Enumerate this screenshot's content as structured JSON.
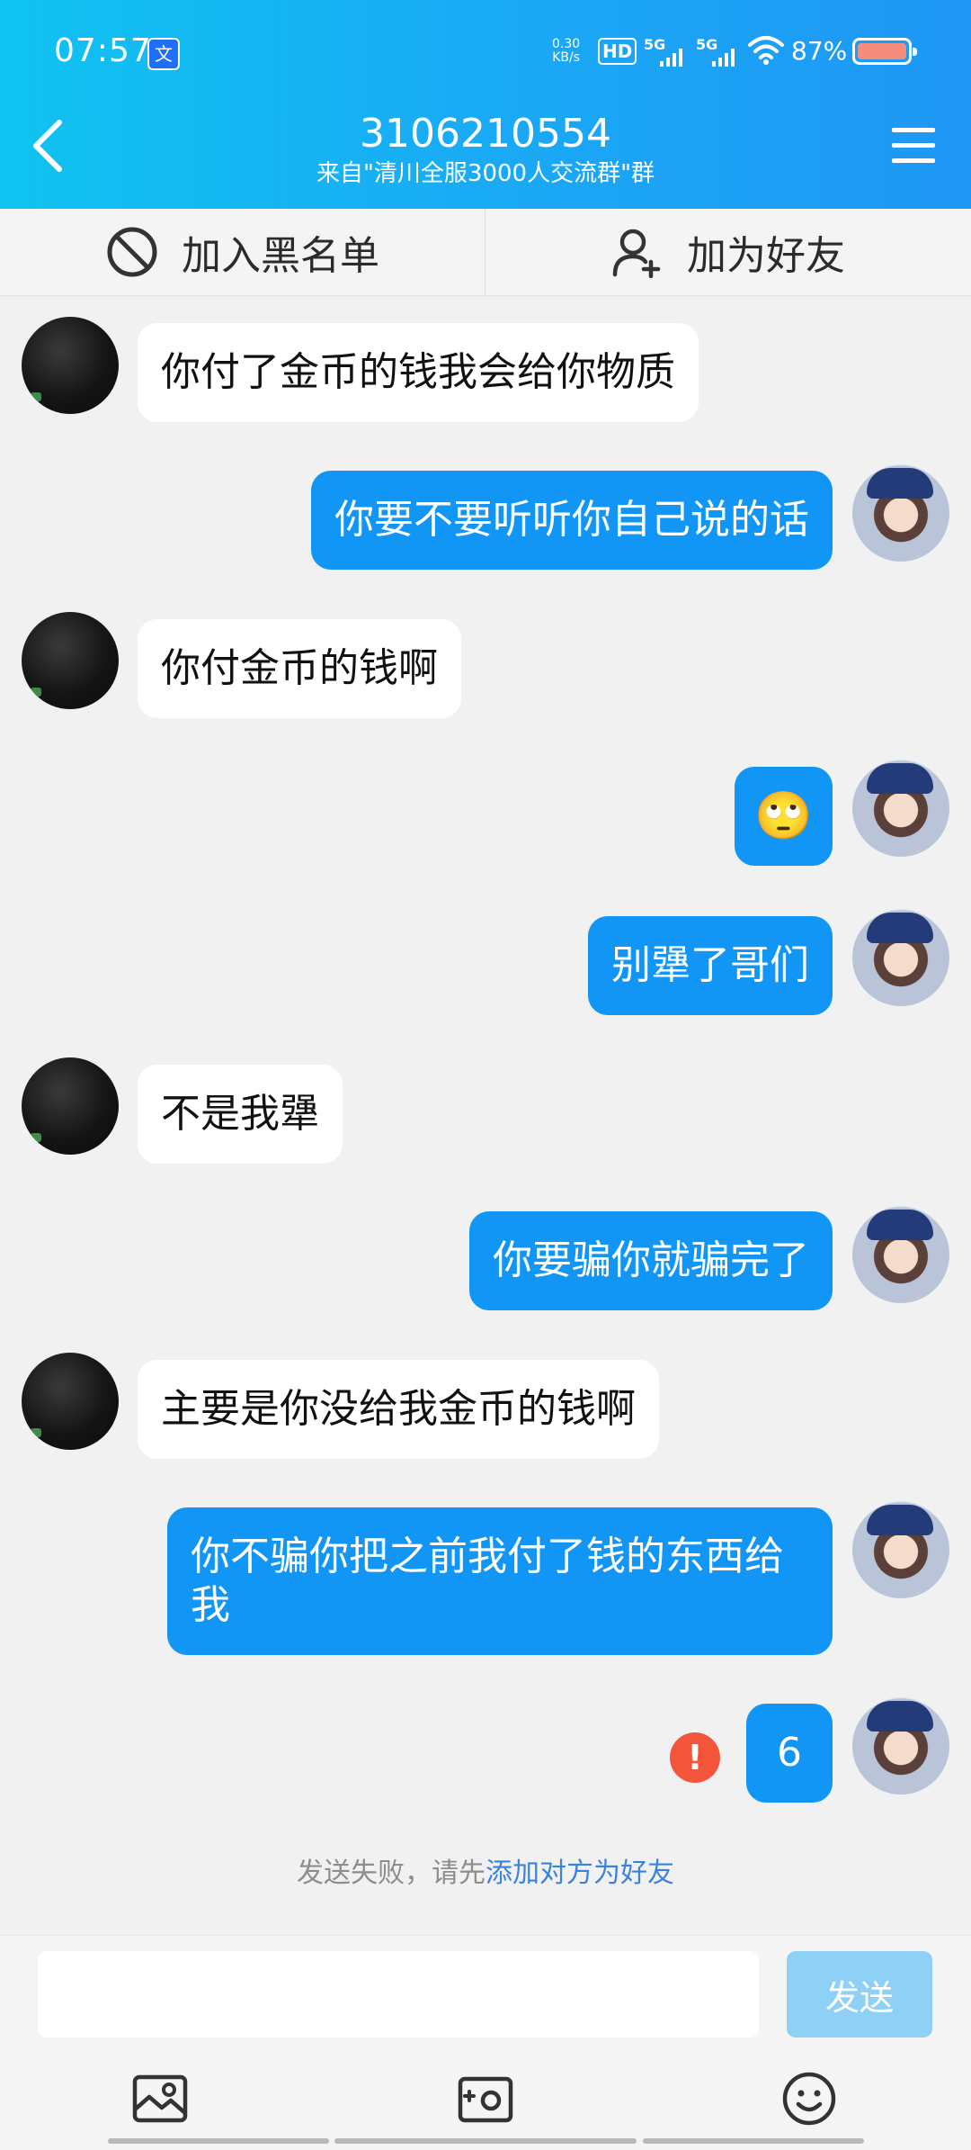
{
  "status_bar": {
    "time": "07:57",
    "app_icon": "文",
    "network_speed_value": "0.30",
    "network_speed_unit": "KB/s",
    "hd_label": "HD",
    "signal_1": "5G",
    "signal_2": "5G",
    "battery_pct": "87%"
  },
  "header": {
    "title": "3106210554",
    "subtitle": "来自\"清川全服3000人交流群\"群"
  },
  "actions": {
    "blacklist_label": "加入黑名单",
    "add_friend_label": "加为好友"
  },
  "messages": [
    {
      "sender": "other",
      "text": "你付了金币的钱我会给你物质"
    },
    {
      "sender": "me",
      "text": "你要不要听听你自己说的话"
    },
    {
      "sender": "other",
      "text": "你付金币的钱啊"
    },
    {
      "sender": "me",
      "type": "emoji",
      "emoji": "🙄"
    },
    {
      "sender": "me",
      "text": "别犟了哥们"
    },
    {
      "sender": "other",
      "text": "不是我犟"
    },
    {
      "sender": "me",
      "text": "你要骗你就骗完了"
    },
    {
      "sender": "other",
      "text": "主要是你没给我金币的钱啊"
    },
    {
      "sender": "me",
      "text": "你不骗你把之前我付了钱的东西给我"
    },
    {
      "sender": "me",
      "text": "6",
      "failed": true
    }
  ],
  "error_mark": "!",
  "notice": {
    "prefix": "发送失败，请先",
    "link": "添加对方为好友"
  },
  "composer": {
    "input_value": "",
    "send_label": "发送"
  },
  "toolbar_icons": [
    "image-icon",
    "camera-icon",
    "emoji-icon"
  ],
  "colors": {
    "header_gradient_start": "#10c3f0",
    "header_gradient_end": "#1f97f5",
    "my_bubble": "#1296f5",
    "other_bubble": "#ffffff",
    "error": "#f3553a",
    "send_button_disabled": "#8fd0f7"
  }
}
